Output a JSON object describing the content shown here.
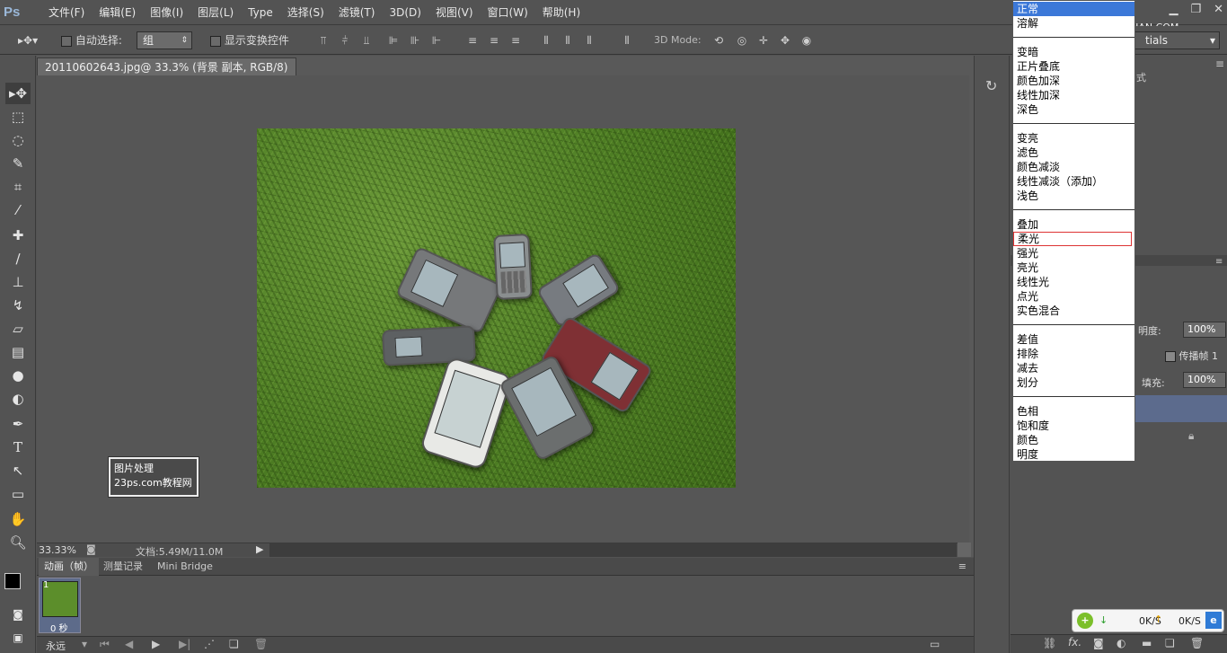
{
  "app": {
    "logo": "Ps",
    "watermark": "思缘设计论坛 WWW.MISSYUAN.COM"
  },
  "menu": [
    "文件(F)",
    "编辑(E)",
    "图像(I)",
    "图层(L)",
    "Type",
    "选择(S)",
    "滤镜(T)",
    "3D(D)",
    "视图(V)",
    "窗口(W)",
    "帮助(H)"
  ],
  "options": {
    "auto_select_label": "自动选择:",
    "auto_select_value": "组",
    "show_transform_label": "显示变换控件",
    "mode_label": "3D Mode:",
    "workspace": "tials"
  },
  "document": {
    "tab_title": "20110602643.jpg@ 33.3% (背景 副本, RGB/8) *",
    "zoom": "33.33%",
    "doc_info": "文档:5.49M/11.0M"
  },
  "stamp": {
    "line1": "图片处理",
    "line2": "23ps.com教程网"
  },
  "anim": {
    "tabs": [
      "动画（帧）",
      "测量记录",
      "Mini Bridge"
    ],
    "frame_number": "1",
    "frame_time": "0 秒",
    "loop": "永远"
  },
  "layers": {
    "opacity_label": "明度:",
    "opacity_value": "100%",
    "propagate_label": "传播帧 1",
    "fill_label": "填充:",
    "fill_value": "100%",
    "panel_tab": "式"
  },
  "blend_modes": {
    "groups": [
      [
        "正常",
        "溶解"
      ],
      [
        "变暗",
        "正片叠底",
        "颜色加深",
        "线性加深",
        "深色"
      ],
      [
        "变亮",
        "滤色",
        "颜色减淡",
        "线性减淡（添加）",
        "浅色"
      ],
      [
        "叠加",
        "柔光",
        "强光",
        "亮光",
        "线性光",
        "点光",
        "实色混合"
      ],
      [
        "差值",
        "排除",
        "减去",
        "划分"
      ],
      [
        "色相",
        "饱和度",
        "颜色",
        "明度"
      ]
    ],
    "selected": "正常",
    "highlighted": "柔光"
  },
  "network": {
    "down": "0K/S",
    "up": "0K/S"
  }
}
